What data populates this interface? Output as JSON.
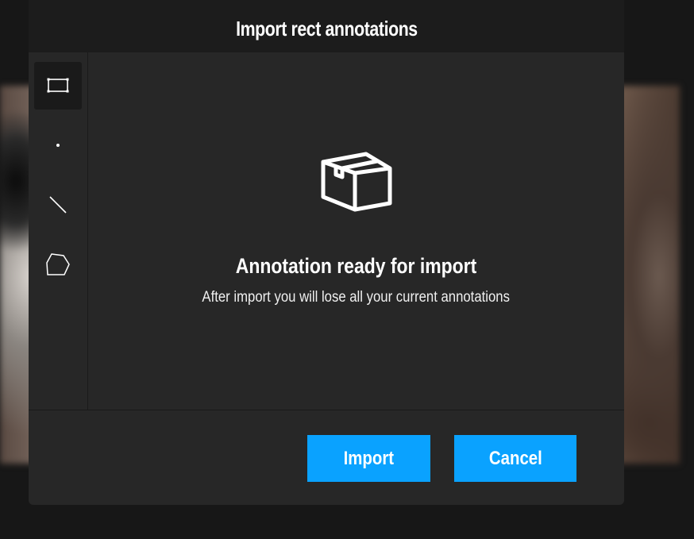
{
  "modal": {
    "title": "Import rect annotations"
  },
  "toolbar": {
    "tools": [
      {
        "icon": "rectangle-icon",
        "active": true
      },
      {
        "icon": "point-icon",
        "active": false
      },
      {
        "icon": "line-icon",
        "active": false
      },
      {
        "icon": "polygon-icon",
        "active": false
      }
    ]
  },
  "content": {
    "icon": "box-icon",
    "title": "Annotation ready for import",
    "subtitle": "After import you will lose all your current annotations"
  },
  "buttons": {
    "import_label": "Import",
    "cancel_label": "Cancel"
  },
  "colors": {
    "accent": "#0aa2ff",
    "modal_bg": "#272727",
    "header_bg": "#1c1c1c"
  }
}
